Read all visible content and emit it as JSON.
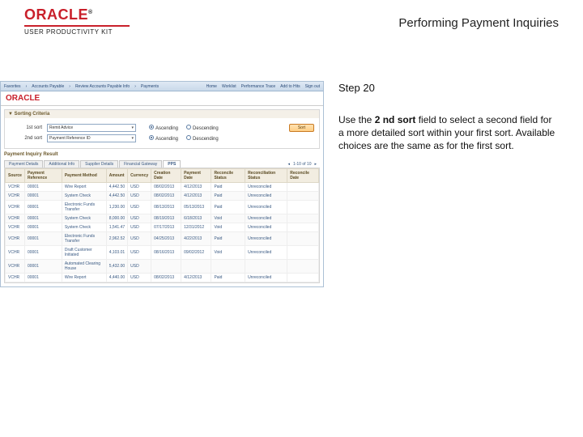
{
  "brand": {
    "oracle": "ORACLE",
    "upk": "USER PRODUCTIVITY KIT"
  },
  "page_title": "Performing Payment Inquiries",
  "instruction": {
    "step": "Step 20",
    "pre": "Use the ",
    "bold": "2 nd sort",
    "post": " field to select a second field for a more detailed sort within your first sort. Available choices are the same as for the first sort."
  },
  "app": {
    "topbar": [
      "Favorites",
      "Accounts Payable",
      "Review Accounts Payable Info",
      "Payments"
    ],
    "navright": [
      "Home",
      "Worklist",
      "Performance Trace",
      "Add to Hits",
      "Sign out"
    ],
    "brand": "ORACLE",
    "sorting_header": "Sorting Criteria",
    "sort1_label": "1st sort",
    "sort1_value": "Remit Advice",
    "sort2_label": "2nd sort",
    "sort2_value": "Payment Reference ID",
    "radio_asc": "Ascending",
    "radio_desc": "Descending",
    "sort_btn": "Sort",
    "pay_hdr": "Payment Inquiry Result",
    "tabs": [
      "Payment Details",
      "Additional Info",
      "Supplier Details",
      "Financial Gateway",
      "PPS"
    ],
    "pager": "1-10 of 10",
    "columns": [
      "Source",
      "Payment Reference",
      "Payment Method",
      "Amount",
      "Currency",
      "Creation Date",
      "Payment Date",
      "Reconcile Status",
      "Reconciliation Status",
      "Reconcile Date"
    ],
    "rows": [
      [
        "VCHR",
        "00001",
        "Wire Report",
        "4,442.50",
        "USD",
        "08/02/2013",
        "4/12/2013",
        "Paid",
        "Unreconciled",
        ""
      ],
      [
        "VCHR",
        "00001",
        "System Check",
        "4,442.50",
        "USD",
        "08/02/2013",
        "4/12/2013",
        "Paid",
        "Unreconciled",
        ""
      ],
      [
        "VCHR",
        "00001",
        "Electronic Funds Transfer",
        "1,230.00",
        "USD",
        "08/13/2013",
        "05/13/2013",
        "Paid",
        "Unreconciled",
        ""
      ],
      [
        "VCHR",
        "00001",
        "System Check",
        "8,000.00",
        "USD",
        "08/19/2013",
        "6/18/2013",
        "Void",
        "Unreconciled",
        ""
      ],
      [
        "VCHR",
        "00001",
        "System Check",
        "1,541.47",
        "USD",
        "07/17/2013",
        "12/31/2012",
        "Void",
        "Unreconciled",
        ""
      ],
      [
        "VCHR",
        "00001",
        "Electronic Funds Transfer",
        "2,962.52",
        "USD",
        "04/25/2013",
        "4/22/2013",
        "Paid",
        "Unreconciled",
        ""
      ],
      [
        "VCHR",
        "00001",
        "Draft Customer Initiated",
        "4,103.01",
        "USD",
        "08/16/2013",
        "09/02/2012",
        "Void",
        "Unreconciled",
        ""
      ],
      [
        "VCHR",
        "00001",
        "Automated Clearing House",
        "5,432.00",
        "USD",
        "",
        "",
        "",
        "",
        ""
      ],
      [
        "VCHR",
        "00001",
        "Wire Report",
        "4,440.00",
        "USD",
        "08/02/2013",
        "4/12/2013",
        "Paid",
        "Unreconciled",
        ""
      ]
    ]
  }
}
